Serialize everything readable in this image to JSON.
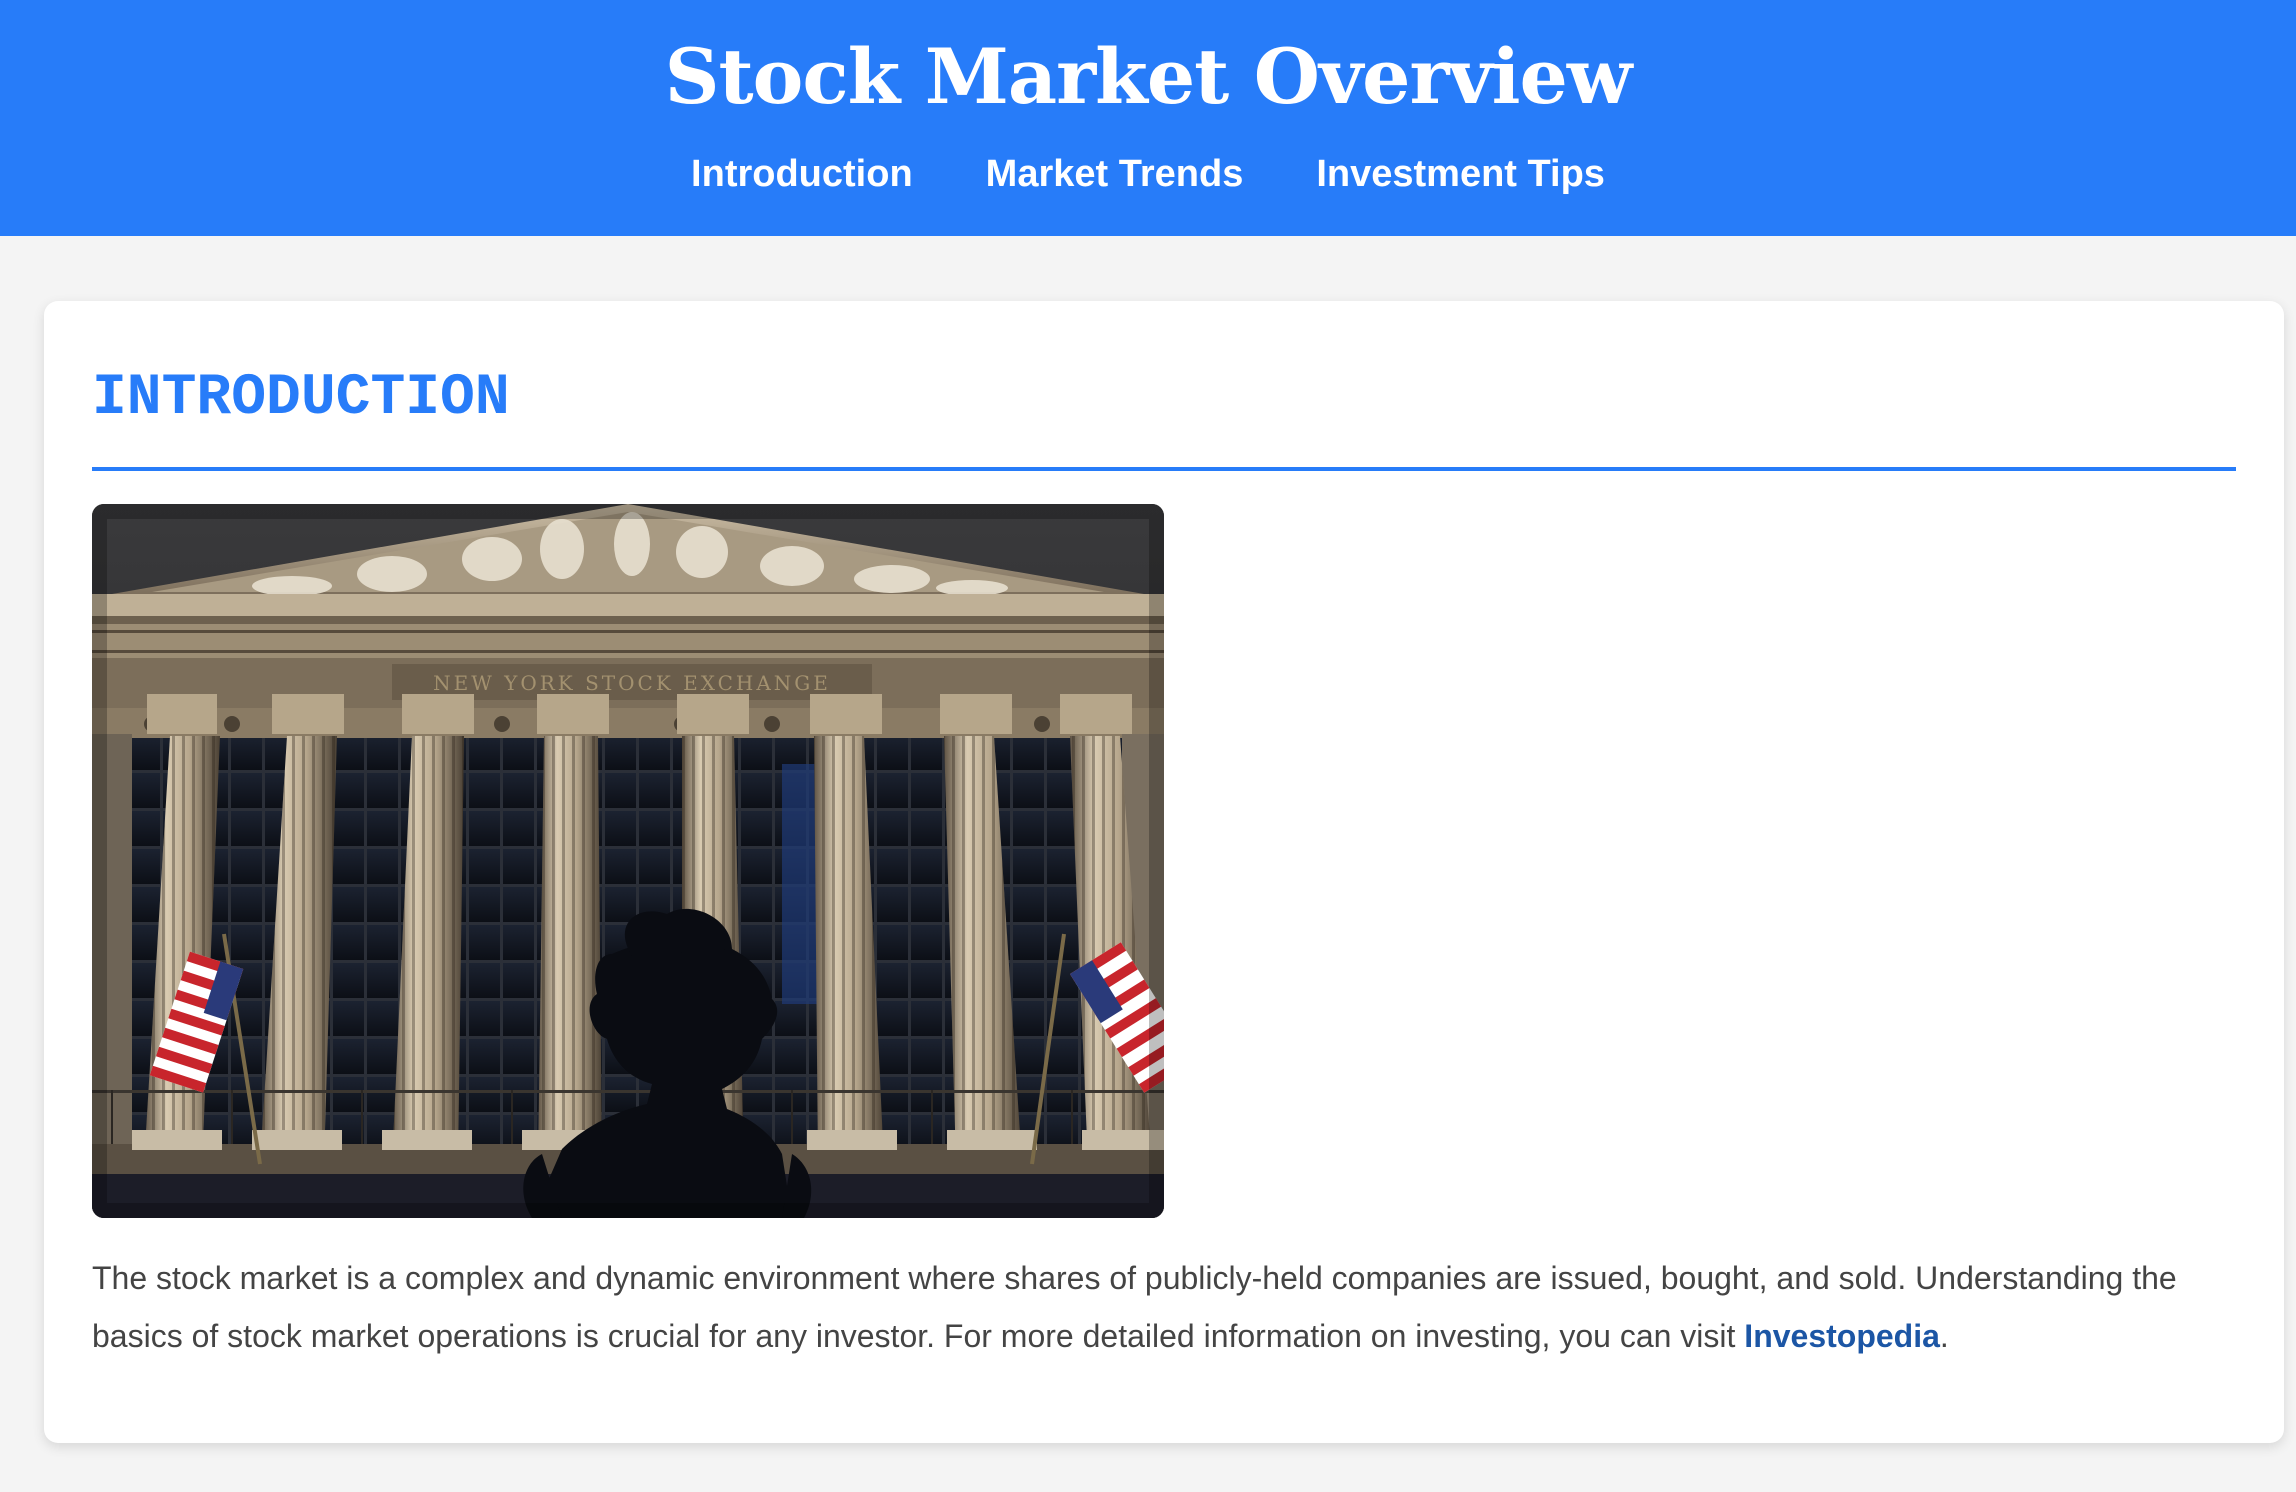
{
  "header": {
    "title": "Stock Market Overview",
    "nav": [
      {
        "label": "Introduction"
      },
      {
        "label": "Market Trends"
      },
      {
        "label": "Investment Tips"
      }
    ]
  },
  "section": {
    "title": "INTRODUCTION",
    "image": {
      "inscription": "NEW YORK STOCK EXCHANGE"
    },
    "paragraph": {
      "text": "The stock market is a complex and dynamic environment where shares of publicly-held companies are issued, bought, and sold. Understanding the basics of stock market operations is crucial for any investor. For more detailed information on investing, you can visit ",
      "link_text": "Investopedia",
      "trailing": "."
    }
  },
  "colors": {
    "header_background": "#277cf9",
    "accent": "#277cf9",
    "link": "#1c56a5",
    "body_text": "#444444",
    "page_background": "#f4f4f4"
  },
  "icons": [
    "building-photo"
  ]
}
